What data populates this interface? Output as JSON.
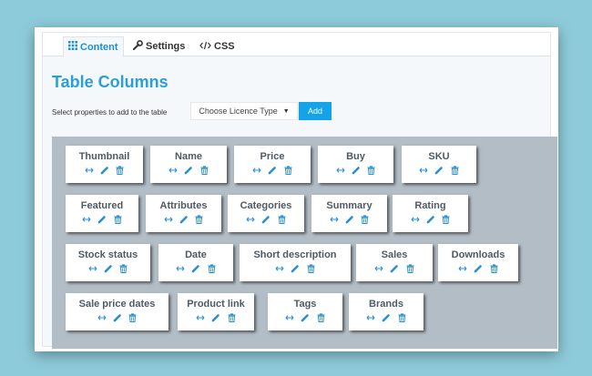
{
  "tabs": [
    {
      "label": "Content",
      "icon": "grid-icon",
      "active": true
    },
    {
      "label": "Settings",
      "icon": "wrench-icon",
      "active": false
    },
    {
      "label": "CSS",
      "icon": "code-icon",
      "active": false
    }
  ],
  "page_title": "Table Columns",
  "selector": {
    "label": "Select properties to add to the table",
    "value": "Choose Licence Type",
    "add_label": "Add"
  },
  "colors": {
    "accent": "#2a9fd8",
    "button": "#14a3e8",
    "panel": "#b2bdc6",
    "icon": "#2a8fd0",
    "background": "#8ecbda"
  },
  "columns": [
    {
      "label": "Thumbnail"
    },
    {
      "label": "Name"
    },
    {
      "label": "Price"
    },
    {
      "label": "Buy"
    },
    {
      "label": "SKU"
    },
    {
      "label": "Featured"
    },
    {
      "label": "Attributes"
    },
    {
      "label": "Categories"
    },
    {
      "label": "Summary"
    },
    {
      "label": "Rating"
    },
    {
      "label": "Stock status"
    },
    {
      "label": "Date"
    },
    {
      "label": "Short description"
    },
    {
      "label": "Sales"
    },
    {
      "label": "Downloads"
    },
    {
      "label": "Sale price dates"
    },
    {
      "label": "Product link"
    },
    {
      "label": "Tags"
    },
    {
      "label": "Brands"
    }
  ],
  "card_actions": [
    "move-icon",
    "edit-icon",
    "delete-icon"
  ]
}
